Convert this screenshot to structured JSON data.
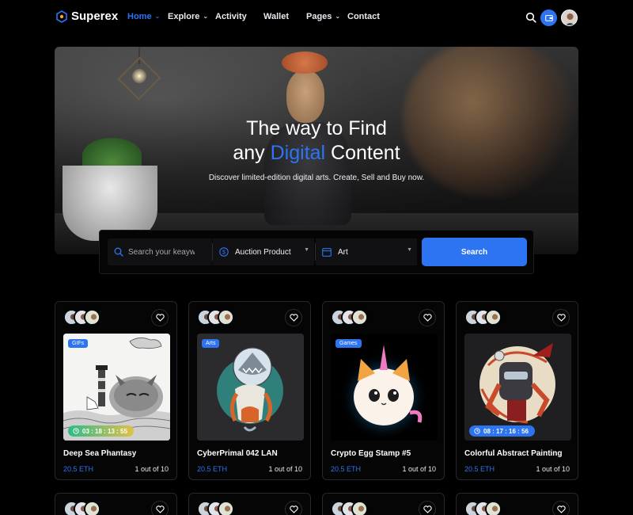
{
  "brand": {
    "name": "Superex"
  },
  "nav": {
    "items": [
      {
        "label": "Home",
        "has_dropdown": true,
        "active": true
      },
      {
        "label": "Explore",
        "has_dropdown": true,
        "active": false
      },
      {
        "label": "Activity",
        "has_dropdown": false,
        "active": false
      },
      {
        "label": "Wallet",
        "has_dropdown": false,
        "active": false
      },
      {
        "label": "Pages",
        "has_dropdown": true,
        "active": false
      },
      {
        "label": "Contact",
        "has_dropdown": false,
        "active": false
      }
    ],
    "icons": [
      "search-icon",
      "wallet-icon",
      "user-avatar"
    ]
  },
  "hero": {
    "title_line1": "The way to Find",
    "title_line2_pre": "any ",
    "title_line2_highlight": "Digital",
    "title_line2_post": " Content",
    "subtitle": "Discover limited-edition digital arts. Create, Sell and Buy now."
  },
  "search": {
    "keyword_placeholder": "Search your keaywords",
    "category_value": "Auction Product",
    "type_value": "Art",
    "button_label": "Search"
  },
  "colors": {
    "accent": "#2c74f2",
    "background": "#000000",
    "card_border": "#26262c"
  },
  "cards": [
    {
      "tag": "GIFs",
      "timer": "03 : 18 : 13 : 55",
      "title": "Deep Sea Phantasy",
      "price": "20.5 ETH",
      "qty": "1 out of 10"
    },
    {
      "tag": "Arts",
      "timer": "",
      "title": "CyberPrimal 042 LAN",
      "price": "20.5 ETH",
      "qty": "1 out of 10"
    },
    {
      "tag": "Games",
      "timer": "",
      "title": "Crypto Egg Stamp #5",
      "price": "20.5 ETH",
      "qty": "1 out of 10"
    },
    {
      "tag": "",
      "timer": "08 : 17 : 16 : 56",
      "title": "Colorful Abstract Painting",
      "price": "20.5 ETH",
      "qty": "1 out of 10"
    }
  ]
}
